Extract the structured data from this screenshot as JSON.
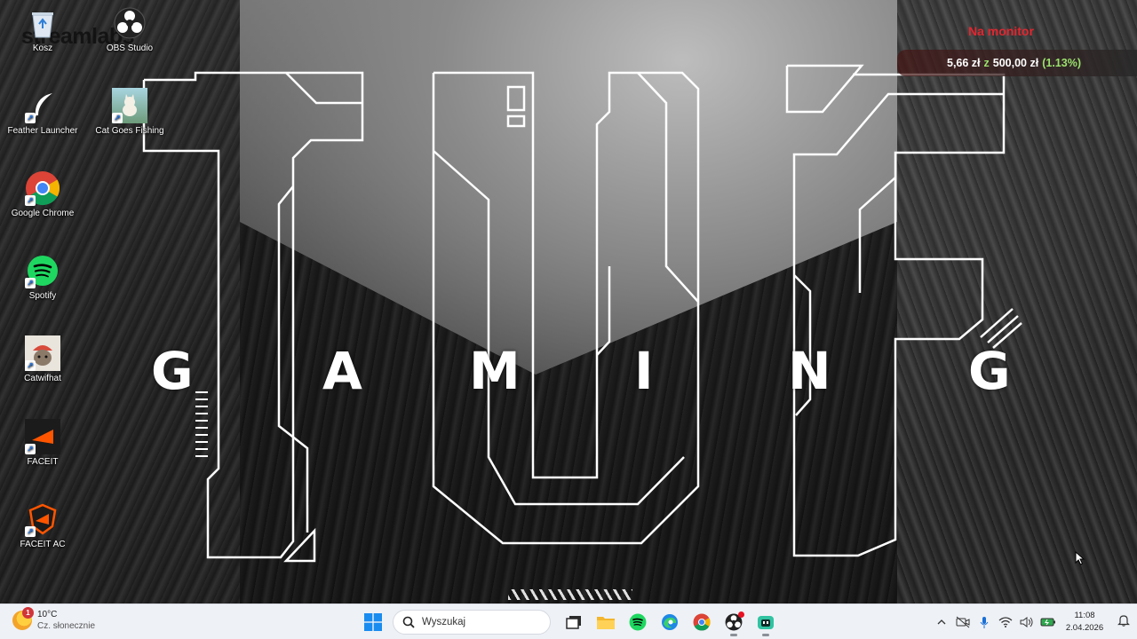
{
  "desktop": {
    "brand_overlay": "streamlabs",
    "icons": [
      {
        "label": "Kosz",
        "icon": "recycle-bin-icon"
      },
      {
        "label": "OBS Studio",
        "icon": "obs-icon"
      },
      {
        "label": "Feather Launcher",
        "icon": "feather-icon"
      },
      {
        "label": "Cat Goes Fishing",
        "icon": "cat-goes-fishing-icon"
      },
      {
        "label": "Google Chrome",
        "icon": "chrome-icon"
      },
      {
        "label": "Spotify",
        "icon": "spotify-icon"
      },
      {
        "label": "Catwifhat",
        "icon": "catwifhat-icon"
      },
      {
        "label": "FACEIT",
        "icon": "faceit-icon"
      },
      {
        "label": "FACEIT AC",
        "icon": "faceit-ac-icon"
      }
    ]
  },
  "wallpaper": {
    "letters": [
      "G",
      "A",
      "M",
      "I",
      "N",
      "G"
    ]
  },
  "stock_widget": {
    "title": "Na monitor",
    "price": "5,66 zł",
    "separator": "z",
    "total": "500,00 zł",
    "change": "(1.13%)",
    "title_color": "#e3262f",
    "accent_color": "#9be26d"
  },
  "taskbar": {
    "weather": {
      "badge": "1",
      "temp": "10°C",
      "condition": "Cz. słonecznie"
    },
    "search_placeholder": "Wyszukaj",
    "pinned": [
      "start-icon",
      "task-view-icon",
      "file-explorer-icon",
      "spotify-icon",
      "edge-icon",
      "chrome-icon",
      "obs-icon",
      "streamlabs-icon"
    ],
    "tray": {
      "time": "11:08",
      "date": "2.04.2026"
    }
  }
}
